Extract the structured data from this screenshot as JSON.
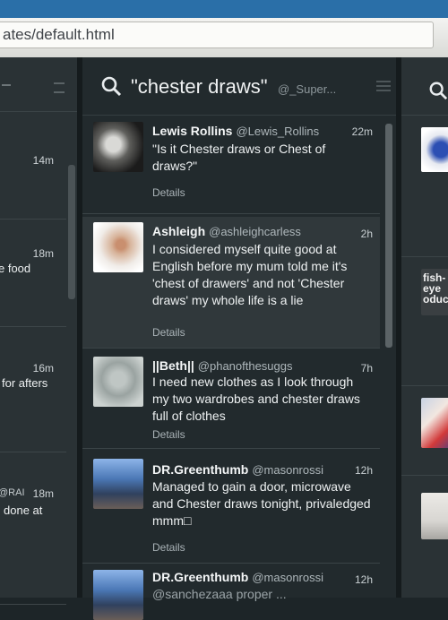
{
  "browser": {
    "url": "ates/default.html"
  },
  "left_column": {
    "items": [
      {
        "time": "14m",
        "text": ""
      },
      {
        "time": "18m",
        "text": "e food"
      },
      {
        "time": "16m",
        "text": "for afters"
      },
      {
        "time": "18m",
        "text": "done at",
        "handle_fragment": "@RAI"
      }
    ]
  },
  "main_column": {
    "title": "\"chester draws\"",
    "user": "@_Super...",
    "tweets": [
      {
        "name": "Lewis Rollins",
        "handle": "@Lewis_Rollins",
        "time": "22m",
        "text": "\"Is it Chester draws or Chest of draws?\"",
        "details": "Details"
      },
      {
        "name": "Ashleigh",
        "handle": "@ashleighcarless",
        "time": "2h",
        "text": "I considered myself quite good at English before my mum told me it's 'chest of drawers' and not 'Chester draws' my whole life is a lie",
        "details": "Details"
      },
      {
        "name": "||Beth||",
        "handle": "@phanofthesuggs",
        "time": "7h",
        "text": "I need new clothes as I look through my two wardrobes and chester draws full of clothes",
        "details": "Details"
      },
      {
        "name": "DR.Greenthumb",
        "handle": "@masonrossi",
        "time": "12h",
        "text": "Managed to gain a door, microwave and Chester draws tonight, privaledged mmm□",
        "details": "Details"
      },
      {
        "name": "DR.Greenthumb",
        "handle": "@masonrossi",
        "time": "12h",
        "text": "@sanchezaaa proper ...",
        "details": ""
      }
    ]
  },
  "right_column": {
    "thumb_text": "fish- eye oductio"
  },
  "colors": {
    "background": "#1d2528",
    "column": "#222a2d",
    "text": "#eef1f2",
    "muted": "#aab3b7"
  }
}
